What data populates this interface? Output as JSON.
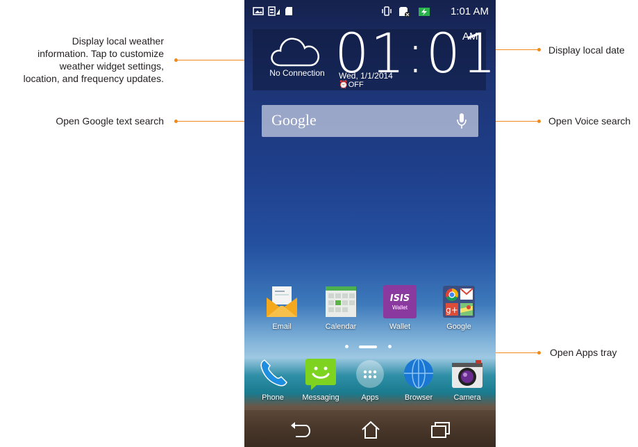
{
  "callouts": {
    "weather": "Display local weather information. Tap to customize weather widget settings, location, and frequency updates.",
    "weather_lines": [
      "Display local weather",
      "information. Tap to customize",
      "weather widget settings,",
      "location, and frequency updates."
    ],
    "google_text": "Open Google text search",
    "date": "Display local date",
    "voice": "Open Voice search",
    "apps_tray": "Open Apps tray"
  },
  "status_bar": {
    "time": "1:01 AM",
    "left_icons": [
      "image-icon",
      "sim-signal-icon",
      "sd-card-icon"
    ],
    "right_icons": [
      "vibrate-icon",
      "no-sim-icon",
      "battery-charging-icon"
    ]
  },
  "clock_widget": {
    "time": "01:01",
    "ampm": "AM",
    "weather_status": "No Connection",
    "date": "Wed, 1/1/2014",
    "alarm": "⏰OFF"
  },
  "search": {
    "placeholder": "Google",
    "voice_icon": "mic-icon"
  },
  "home_apps": [
    {
      "label": "Email",
      "icon": "email-icon"
    },
    {
      "label": "Calendar",
      "icon": "calendar-icon"
    },
    {
      "label": "Wallet",
      "icon": "wallet-icon",
      "badge": "ISIS",
      "sub": "Wallet"
    },
    {
      "label": "Google",
      "icon": "google-folder-icon"
    }
  ],
  "dock_apps": [
    {
      "label": "Phone",
      "icon": "phone-icon"
    },
    {
      "label": "Messaging",
      "icon": "messaging-icon"
    },
    {
      "label": "Apps",
      "icon": "apps-icon"
    },
    {
      "label": "Browser",
      "icon": "browser-icon"
    },
    {
      "label": "Camera",
      "icon": "camera-icon"
    }
  ],
  "colors": {
    "accent": "#f08a1c"
  }
}
